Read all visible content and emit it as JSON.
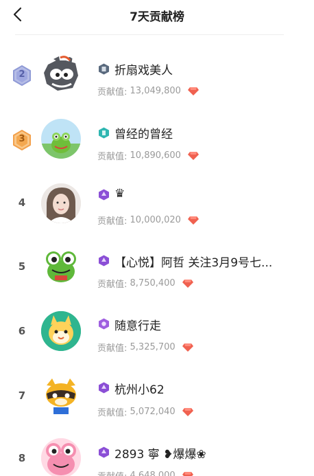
{
  "header": {
    "title": "7天贡献榜"
  },
  "contrib_label": "贡献值: ",
  "colors": {
    "silver_badge": "#8f9ad6",
    "bronze_badge": "#f3a04a",
    "level_purple": "#8b4fd6",
    "level_teal": "#2fb6b1",
    "level_gray": "#5a6a7e",
    "gem_red": "#f06150"
  },
  "rows": [
    {
      "rank": "2",
      "badge": "silver-hex",
      "level_badge": "shield-icon",
      "nickname": "折扇戏美人",
      "contrib": "13,049,800"
    },
    {
      "rank": "3",
      "badge": "bronze-hex",
      "level_badge": "shield-icon",
      "nickname": "曾经的曾经",
      "contrib": "10,890,600"
    },
    {
      "rank": "4",
      "level_badge": "shield-icon",
      "nickname": "♛",
      "contrib": "10,000,020"
    },
    {
      "rank": "5",
      "level_badge": "shield-icon",
      "nickname": "【心悦】阿哲 关注3月9号七...",
      "contrib": "8,750,400"
    },
    {
      "rank": "6",
      "level_badge": "shield-icon",
      "nickname": "随意行走",
      "contrib": "5,325,700"
    },
    {
      "rank": "7",
      "level_badge": "shield-icon",
      "nickname": "杭州小62",
      "contrib": "5,072,040"
    },
    {
      "rank": "8",
      "level_badge": "shield-icon",
      "nickname": "2893 寧 ❥爆爆❀",
      "contrib": "4,648,000"
    }
  ]
}
